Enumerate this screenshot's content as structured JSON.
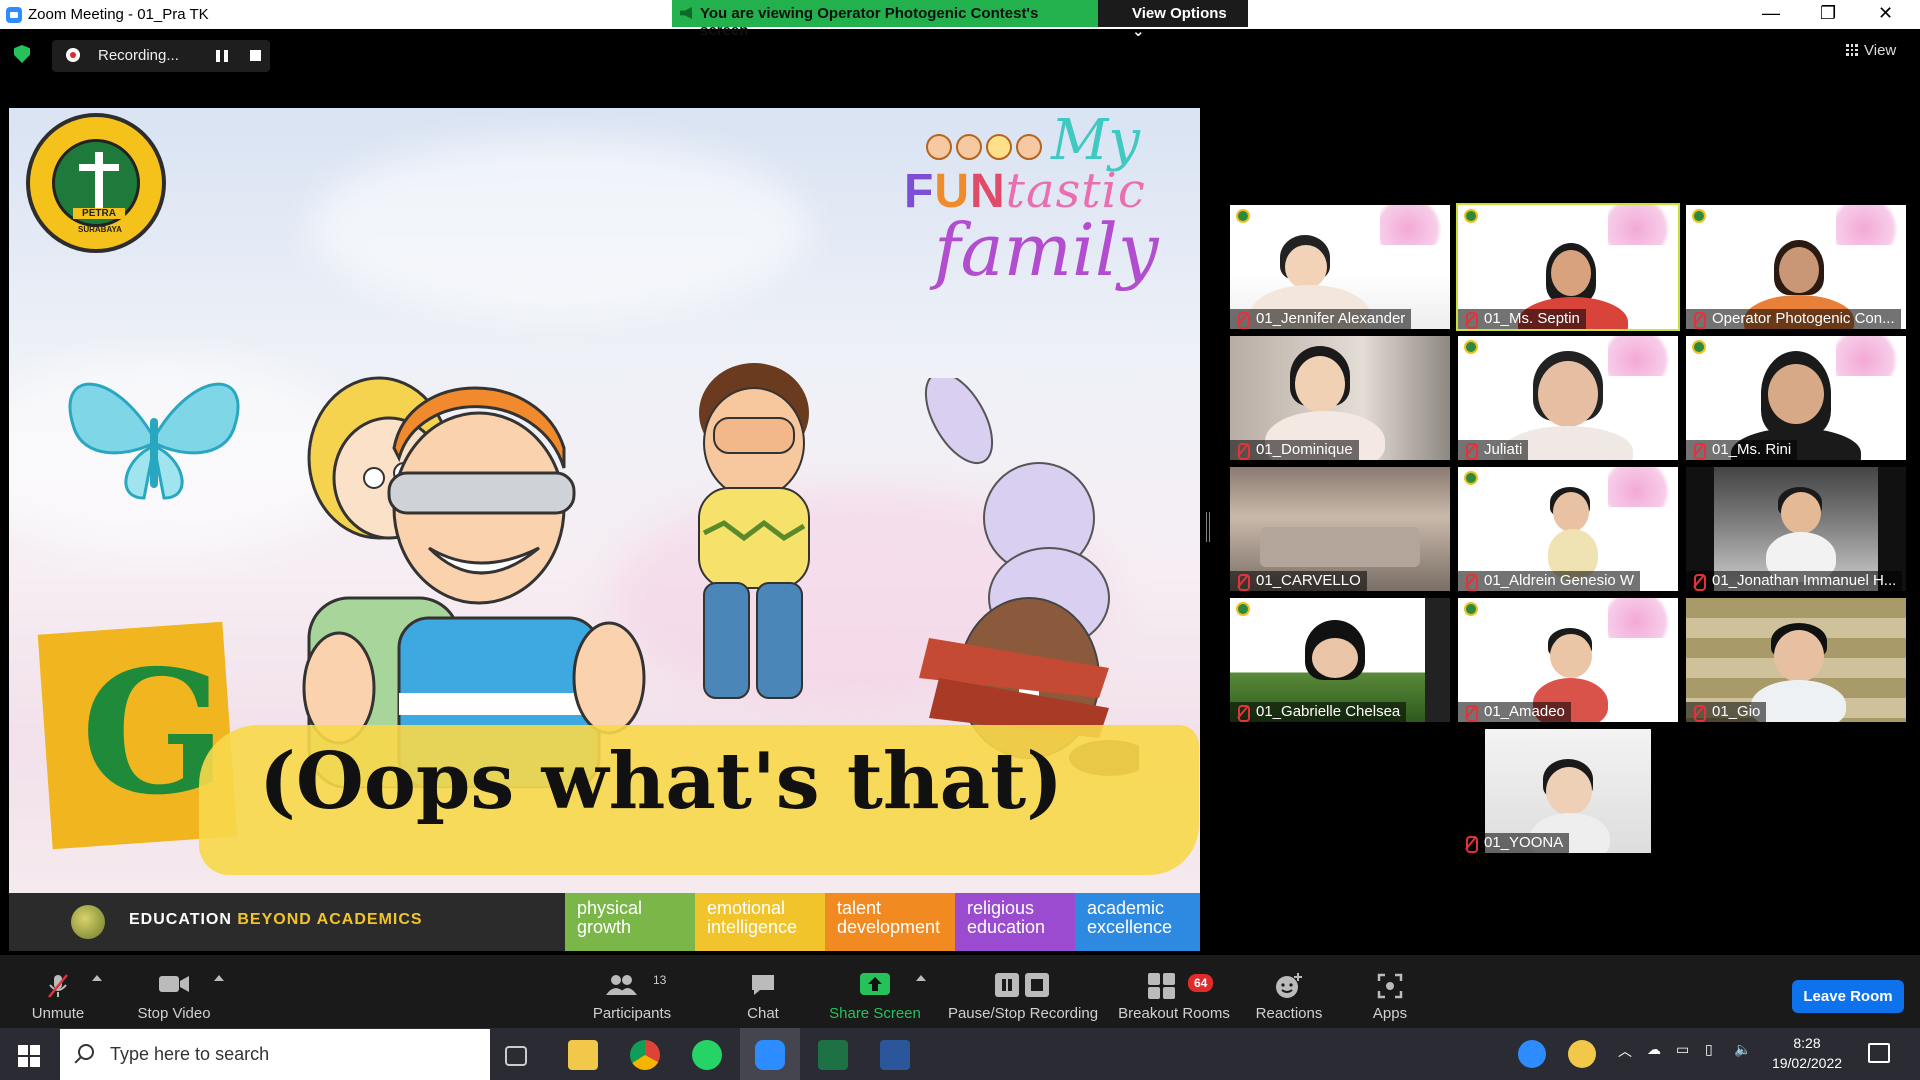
{
  "window": {
    "title": "Zoom Meeting - 01_Pra TK",
    "minimize": "—",
    "maximize": "❐",
    "close": "✕"
  },
  "share_banner": {
    "message": "You are viewing Operator Photogenic Contest's screen",
    "view_options": "View Options ⌄"
  },
  "recording": {
    "label": "Recording..."
  },
  "view_label": "View",
  "slide": {
    "brand_my": "My",
    "brand_fun": [
      "F",
      "U",
      "N",
      "tastic"
    ],
    "brand_family": "family",
    "logo_text": "PETRA",
    "logo_city": "SURABAYA",
    "letter": "G",
    "caption": "(Oops what's that)",
    "footer_tagline_1": "EDUCATION",
    "footer_tagline_2": "BEYOND ACADEMICS",
    "pills": [
      {
        "l1": "physical",
        "l2": "growth",
        "color": "#7ab648"
      },
      {
        "l1": "emotional",
        "l2": "intelligence",
        "color": "#f2c42c"
      },
      {
        "l1": "talent",
        "l2": "development",
        "color": "#f28a22"
      },
      {
        "l1": "religious",
        "l2": "education",
        "color": "#9b4bd0"
      },
      {
        "l1": "academic",
        "l2": "excellence",
        "color": "#2d8ae0"
      }
    ]
  },
  "participants": [
    {
      "name": "01_Jennifer Alexander"
    },
    {
      "name": "01_Ms. Septin"
    },
    {
      "name": "Operator Photogenic Con..."
    },
    {
      "name": "01_Dominique"
    },
    {
      "name": "Juliati"
    },
    {
      "name": "01_Ms. Rini"
    },
    {
      "name": "01_CARVELLO"
    },
    {
      "name": "01_Aldrein Genesio W"
    },
    {
      "name": "01_Jonathan Immanuel H..."
    },
    {
      "name": "01_Gabrielle Chelsea"
    },
    {
      "name": "01_Amadeo"
    },
    {
      "name": "01_Gio"
    },
    {
      "name": "01_YOONA"
    }
  ],
  "toolbar": {
    "unmute": "Unmute",
    "stop_video": "Stop Video",
    "participants": "Participants",
    "participants_count": "13",
    "chat": "Chat",
    "share_screen": "Share Screen",
    "pause_stop_recording": "Pause/Stop Recording",
    "breakout_rooms": "Breakout Rooms",
    "breakout_badge": "64",
    "reactions": "Reactions",
    "apps": "Apps",
    "leave_room": "Leave Room"
  },
  "taskbar": {
    "search_placeholder": "Type here to search",
    "time": "8:28",
    "date": "19/02/2022"
  },
  "colors": {
    "share_green": "#22b14c",
    "leave_blue": "#0e72ed",
    "speaker_outline": "#c9e23a",
    "muted_red": "#e0343a"
  }
}
